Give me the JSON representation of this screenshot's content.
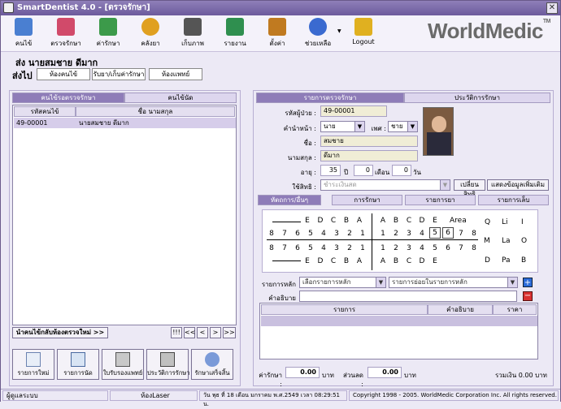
{
  "app": {
    "title": "SmartDentist 4.0 - [ตรวจรักษา]",
    "close_glyph": "✕"
  },
  "toolbar": {
    "items": [
      {
        "label": "คนไข้",
        "icon": "patients-icon",
        "color": "#4a7fd1"
      },
      {
        "label": "ตรวจรักษา",
        "icon": "treatment-icon",
        "color": "#d14a6a"
      },
      {
        "label": "ค่ารักษา",
        "icon": "money-icon",
        "color": "#3c9a4a"
      },
      {
        "label": "คลังยา",
        "icon": "pill-icon",
        "color": "#e0a020"
      },
      {
        "label": "เก็บภาพ",
        "icon": "camera-icon",
        "color": "#555555"
      },
      {
        "label": "รายงาน",
        "icon": "report-chart-icon",
        "color": "#2f8f4f"
      },
      {
        "label": "ตั้งค่า",
        "icon": "settings-tools-icon",
        "color": "#c07a20"
      },
      {
        "label": "ช่วยเหลือ",
        "icon": "help-icon",
        "color": "#3a6ad0"
      },
      {
        "label": "Logout",
        "icon": "lock-icon",
        "color": "#e0b020"
      }
    ],
    "logo": "WorldMedic",
    "logo_tm": "TM",
    "help_arrow": "▼"
  },
  "patient_line": "ส่ง  นายสมชาย ดีมาก",
  "send_to": {
    "label": "ส่งไป",
    "buttons": [
      "ห้องคนไข้",
      "รับยา/เก็บค่ารักษา",
      "ห้องแพทย์"
    ]
  },
  "left_panel": {
    "tabs": [
      "คนไข้รอตรวจรักษา",
      "คนไข้นัด"
    ],
    "columns": [
      "รหัสคนไข้",
      "ชื่อ นามสกุล"
    ],
    "rows": [
      {
        "id": "49-00001",
        "name": "นายสมชาย ดีมาก"
      }
    ],
    "refresh_button": "นำคนไข้กลับห้องตรวจใหม่ >>",
    "nav": [
      "!!!",
      "<<",
      "<",
      ">",
      ">>"
    ],
    "actions": [
      {
        "label": "รายการใหม่",
        "icon": "new-document-icon"
      },
      {
        "label": "รายการนัด",
        "icon": "calendar-icon"
      },
      {
        "label": "ใบรับรองแพทย์",
        "icon": "printer-icon"
      },
      {
        "label": "ประวัติการรักษา",
        "icon": "history-print-icon"
      },
      {
        "label": "รักษาเสร็จสิ้น",
        "icon": "doctors-icon"
      }
    ]
  },
  "right_panel": {
    "tabs": [
      "รายการตรวจรักษา",
      "ประวัติการรักษา"
    ],
    "patient": {
      "id_label": "รหัสผู้ป่วย :",
      "id": "49-00001",
      "prefix_label": "คำนำหน้า :",
      "prefix": "นาย",
      "sex_label": "เพศ :",
      "sex": "ชาย",
      "name_label": "ชื่อ :",
      "name": "สมชาย",
      "surname_label": "นามสกุล :",
      "surname": "ดีมาก",
      "age_label": "อายุ :",
      "age_years": "35",
      "years_unit": "ปี",
      "age_months": "0",
      "months_unit": "เดือน",
      "age_days": "0",
      "days_unit": "วัน",
      "rights_label": "ใช้สิทธิ :",
      "rights_placeholder": "ชำระเงินสด",
      "change_rights_button": "เปลี่ยนสิทธิ",
      "show_more_button": "แสดงข้อมูลเพิ่มเติม"
    },
    "sub_tabs": [
      "หัตถการ/อื่นๆ",
      "การรักษา",
      "รายการยา",
      "รายการเล็บ"
    ],
    "tooth_chart": {
      "upper_left_letters": [
        "E",
        "D",
        "C",
        "B",
        "A"
      ],
      "upper_right_letters": [
        "A",
        "B",
        "C",
        "D",
        "E"
      ],
      "left_numbers": [
        "8",
        "7",
        "6",
        "5",
        "4",
        "3",
        "2",
        "1"
      ],
      "right_numbers": [
        "1",
        "2",
        "3",
        "4",
        "5",
        "6",
        "7",
        "8"
      ],
      "selected": [
        "5",
        "6"
      ],
      "area_label": "Area",
      "quadrant_labels": [
        "Q",
        "Li",
        "I",
        "M",
        "La",
        "O",
        "D",
        "Pa",
        "B"
      ]
    },
    "main_item_label": "รายการหลัก",
    "main_item_placeholder": "เลือกรายการหลัก",
    "sub_item_placeholder": "รายการย่อยในรายการหลัก",
    "description_label": "คำอธิบาย",
    "table_columns": [
      "รายการ",
      "คำอธิบาย",
      "ราคา"
    ],
    "treatment_cost_label": "ค่ารักษา :",
    "treatment_cost": "0.00",
    "baht1": "บาท",
    "discount_label": "ส่วนลด :",
    "discount": "0.00",
    "baht2": "บาท",
    "total_label": "รวมเงิน 0.00 บาท"
  },
  "status": {
    "user": "ผู้ดูแลระบบ",
    "room": "ห้องLaser",
    "datetime": "วัน พุธ ที่ 18 เดือน มกราคม พ.ศ.2549 เวลา 08:29:51 น.",
    "copyright": "Copyright 1998 - 2005. WorldMedic Corporation Inc. All rights reserved."
  }
}
